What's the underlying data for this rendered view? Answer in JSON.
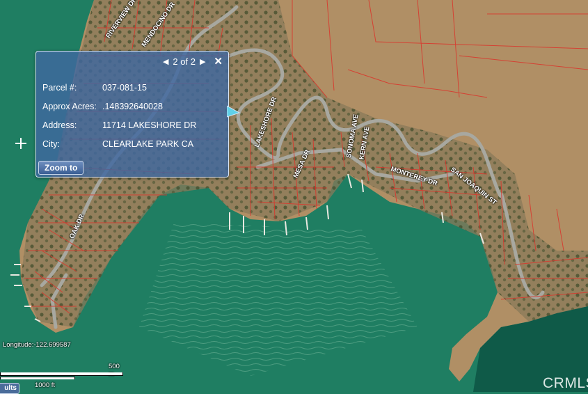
{
  "popup": {
    "pager": "2 of 2",
    "rows": [
      {
        "label": "Parcel #:",
        "value": "037-081-15"
      },
      {
        "label": "Approx Acres:",
        "value": ".148392640028"
      },
      {
        "label": "Address:",
        "value": "11714 LAKESHORE DR"
      },
      {
        "label": "City:",
        "value": "CLEARLAKE PARK CA"
      }
    ],
    "zoom_label": "Zoom to"
  },
  "coordinates": "Longitude:-122.699587",
  "scale": {
    "metric": "500 m",
    "imperial": "1000 ft"
  },
  "tab_label": "ults",
  "watermark": "CRMLS",
  "road_labels": [
    "MONTEREY DR",
    "SAN JOAQUIN ST",
    "LAKESHORE DR",
    "MESA DR",
    "SONOMA AVE",
    "OAK DR",
    "KERN AVE",
    "RIVERVIEW DR",
    "MENDOCINO DR"
  ],
  "colors": {
    "water": "#1f7e62",
    "land": "#b8946a",
    "parcel_lines": "#d8392e",
    "popup": "#4068a0"
  }
}
